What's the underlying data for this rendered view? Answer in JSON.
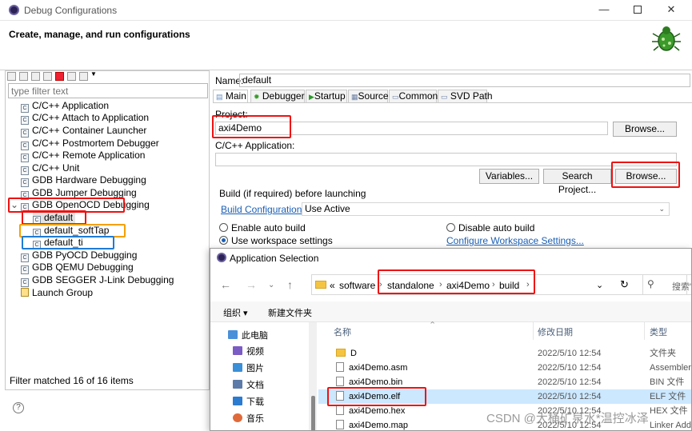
{
  "window": {
    "title": "Debug Configurations",
    "heading": "Create, manage, and run configurations"
  },
  "left": {
    "filter_placeholder": "type filter text",
    "items": [
      {
        "label": "C/C++ Application",
        "badge": "C"
      },
      {
        "label": "C/C++ Attach to Application",
        "badge": "C"
      },
      {
        "label": "C/C++ Container Launcher",
        "badge": "C"
      },
      {
        "label": "C/C++ Postmortem Debugger",
        "badge": "C"
      },
      {
        "label": "C/C++ Remote Application",
        "badge": "C"
      },
      {
        "label": "C/C++ Unit",
        "badge": "C"
      },
      {
        "label": "GDB Hardware Debugging",
        "badge": "C"
      },
      {
        "label": "GDB Jumper Debugging",
        "badge": "C"
      },
      {
        "label": "GDB OpenOCD Debugging",
        "badge": "C"
      },
      {
        "label": "default",
        "badge": "C"
      },
      {
        "label": "default_softTap",
        "badge": "C"
      },
      {
        "label": "default_ti",
        "badge": "C"
      },
      {
        "label": "GDB PyOCD Debugging",
        "badge": "C"
      },
      {
        "label": "GDB QEMU Debugging",
        "badge": "C"
      },
      {
        "label": "GDB SEGGER J-Link Debugging",
        "badge": "C"
      },
      {
        "label": "Launch Group",
        "badge": ""
      }
    ],
    "expand_glyph": "⌄",
    "status": "Filter matched 16 of 16 items",
    "help": "?"
  },
  "right": {
    "name_label": "Name:",
    "name_value": "default",
    "tabs": [
      "Main",
      "Debugger",
      "Startup",
      "Source",
      "Common",
      "SVD Path"
    ],
    "project_label": "Project:",
    "project_value": "axi4Demo",
    "browse": "Browse...",
    "app_label": "C/C++ Application:",
    "app_value": "",
    "variables": "Variables...",
    "search_project": "Search Project...",
    "browse2": "Browse...",
    "build_label": "Build (if required) before launching",
    "build_config_link": "Build Configuration:",
    "build_config_value": "Use Active",
    "enable_auto": "Enable auto build",
    "disable_auto": "Disable auto build",
    "use_workspace": "Use workspace settings",
    "configure_link": "Configure Workspace Settings..."
  },
  "dialog": {
    "title": "Application Selection",
    "crumbs": [
      "«",
      "software",
      "standalone",
      "axi4Demo",
      "build"
    ],
    "search_placeholder": "搜索\"",
    "organize": "组织 ▾",
    "new_folder": "新建文件夹",
    "side": [
      {
        "label": "此电脑",
        "color": "#4a90d9"
      },
      {
        "label": "视频",
        "color": "#7b5cc4"
      },
      {
        "label": "图片",
        "color": "#3a8fd8"
      },
      {
        "label": "文档",
        "color": "#5c7ba8"
      },
      {
        "label": "下载",
        "color": "#2b7bd1"
      },
      {
        "label": "音乐",
        "color": "#e06a3a"
      }
    ],
    "columns": {
      "name": "名称",
      "date": "修改日期",
      "type": "类型"
    },
    "files": [
      {
        "name": "D",
        "date": "2022/5/10 12:54",
        "type": "文件夹",
        "folder": true
      },
      {
        "name": "axi4Demo.asm",
        "date": "2022/5/10 12:54",
        "type": "Assembler",
        "folder": false
      },
      {
        "name": "axi4Demo.bin",
        "date": "2022/5/10 12:54",
        "type": "BIN 文件",
        "folder": false
      },
      {
        "name": "axi4Demo.elf",
        "date": "2022/5/10 12:54",
        "type": "ELF 文件",
        "folder": false
      },
      {
        "name": "axi4Demo.hex",
        "date": "2022/5/10 12:54",
        "type": "HEX 文件",
        "folder": false
      },
      {
        "name": "axi4Demo.map",
        "date": "2022/5/10 12:54",
        "type": "Linker Add",
        "folder": false
      }
    ]
  },
  "watermark": "CSDN @大桶矿泉水*温控冰泽",
  "colors": {
    "highlight_red": "#e11111",
    "highlight_orange": "#f5a000",
    "highlight_blue": "#1e7bd6",
    "selection": "#cce8ff",
    "link": "#1a5fb4"
  }
}
